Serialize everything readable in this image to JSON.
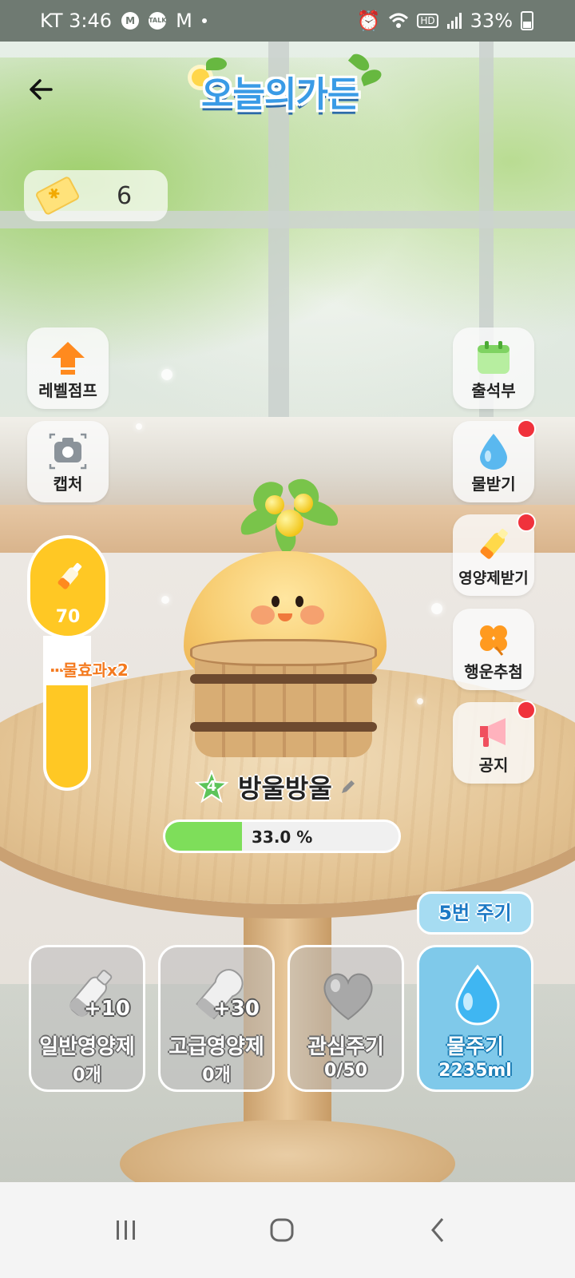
{
  "status_bar": {
    "carrier_time": "KT 3:46",
    "app_icons": [
      "M",
      "TALK",
      "M"
    ],
    "battery": "33%"
  },
  "header": {
    "logo_text": "오늘의가든"
  },
  "tickets": {
    "count": "6"
  },
  "left_buttons": [
    {
      "label": "레벨점프"
    },
    {
      "label": "캡처"
    }
  ],
  "right_buttons": [
    {
      "label": "출석부",
      "badge": false
    },
    {
      "label": "물받기",
      "badge": true
    },
    {
      "label": "영양제받기",
      "badge": true
    },
    {
      "label": "행운추첨",
      "badge": false
    },
    {
      "label": "공지",
      "badge": true
    }
  ],
  "gauge": {
    "value": "70",
    "marker_label": "물효과x2",
    "fill_fraction": 0.68
  },
  "plant": {
    "level": "4",
    "name": "방울방울",
    "progress_text": "33.0 %",
    "progress_percent": 33.0
  },
  "water_times": "5번 주기",
  "actions": [
    {
      "plus": "+10",
      "title": "일반영양제",
      "value": "0개"
    },
    {
      "plus": "+30",
      "title": "고급영양제",
      "value": "0개"
    },
    {
      "plus": "",
      "title": "관심주기",
      "value": "0/50"
    },
    {
      "plus": "",
      "title": "물주기",
      "value": "2235ml"
    }
  ],
  "colors": {
    "accent_blue": "#3a9be6",
    "gauge_yellow": "#ffc824",
    "progress_green": "#7ede5a",
    "badge_red": "#f0323c",
    "water_button": "#7fc9ea"
  }
}
